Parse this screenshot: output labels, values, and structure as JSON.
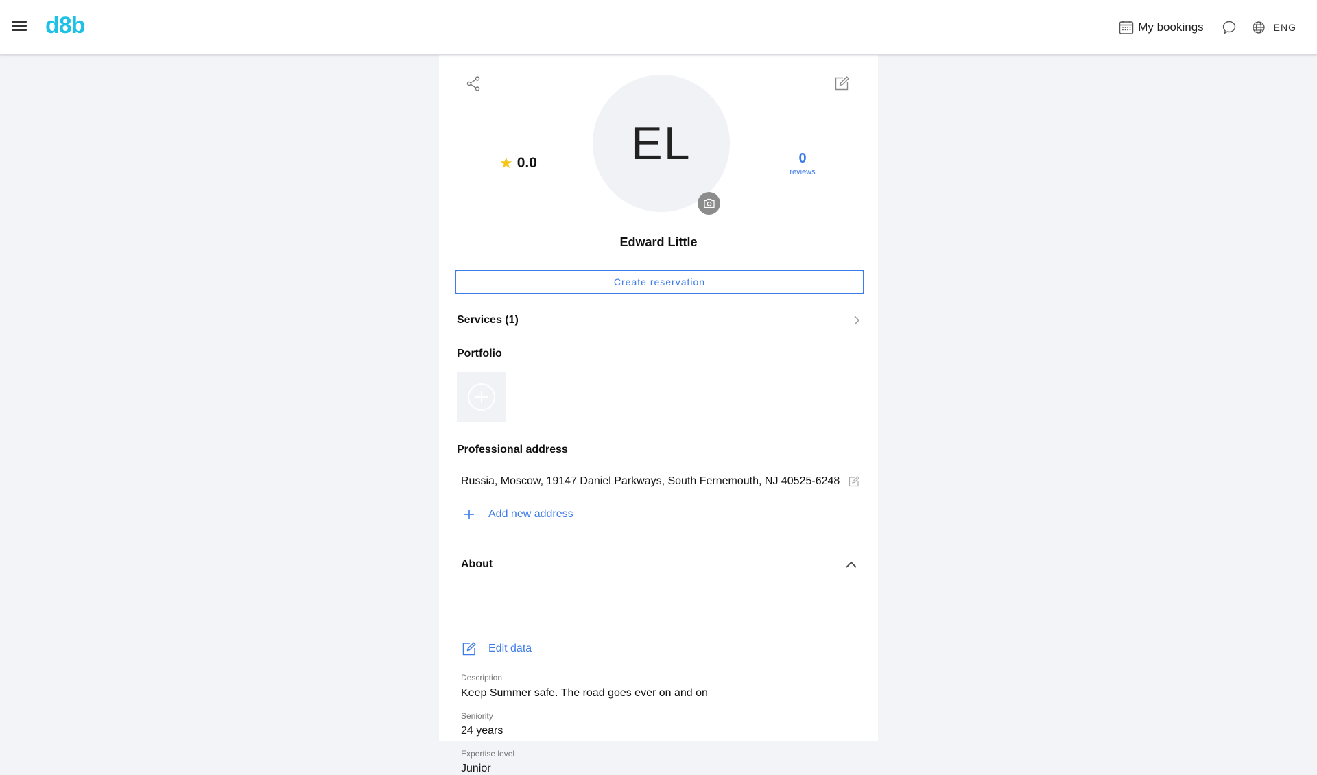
{
  "header": {
    "logo": "d8b",
    "bookings_label": "My bookings",
    "language": "ENG"
  },
  "profile": {
    "initials": "EL",
    "rating": "0.0",
    "reviews_count": "0",
    "reviews_label": "reviews",
    "name": "Edward Little",
    "reserve_label": "Create reservation"
  },
  "services": {
    "label": "Services (1)"
  },
  "portfolio": {
    "title": "Portfolio"
  },
  "address": {
    "title": "Professional address",
    "value": "Russia, Moscow, 19147 Daniel Parkways, South Fernemouth, NJ 40525-6248",
    "add_label": "Add new address"
  },
  "about": {
    "title": "About",
    "edit_label": "Edit data",
    "fields": [
      {
        "label": "Description",
        "value": "Keep Summer safe. The road goes ever on and on"
      },
      {
        "label": "Seniority",
        "value": "24 years"
      },
      {
        "label": "Expertise level",
        "value": "Junior"
      }
    ]
  },
  "colors": {
    "accent": "#3d7be8",
    "logo": "#1ec0e6",
    "star": "#f5c518",
    "background": "#f3f4f8"
  },
  "icons": [
    "menu-icon",
    "calendar-icon",
    "chat-icon",
    "globe-icon",
    "share-icon",
    "edit-icon",
    "star-icon",
    "camera-icon",
    "chevron-right-icon",
    "plus-circle-icon",
    "plus-icon",
    "chevron-up-icon"
  ]
}
